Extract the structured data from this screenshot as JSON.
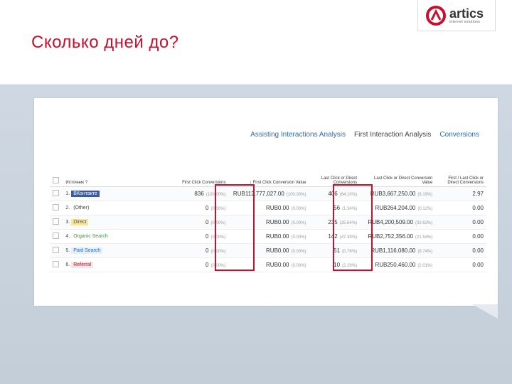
{
  "slide": {
    "title": "Сколько дней до?"
  },
  "logo": {
    "name": "artics",
    "sub": "internet solutions"
  },
  "report": {
    "tabs": [
      "Assisting Interactions Analysis",
      "First Interaction Analysis",
      "Conversions"
    ],
    "columns": {
      "source": "Источник",
      "first_click_conv": "First Click Conversions",
      "first_click_value": "First Click Conversion Value",
      "last_click_conv": "Last Click or Direct Conversions",
      "last_click_value": "Last Click or Direct Conversion Value",
      "ratio": "First / Last Click or Direct Conversions"
    },
    "rows": [
      {
        "num": "1.",
        "name": "ВКонтакте",
        "chip_bg": "#3b5b9a",
        "chip_fg": "#ffffff",
        "fc": "836",
        "fc_pct": "(100.00%)",
        "fv": "RUB112,777,027.00",
        "fv_pct": "(100.00%)",
        "lc": "406",
        "lc_pct": "(64.10%)",
        "lv": "RUB3,667,250.00",
        "lv_pct": "(6.19%)",
        "ratio": "2.97"
      },
      {
        "num": "2.",
        "name": "(Other)",
        "chip_bg": "#ffffff",
        "chip_fg": "#444444",
        "fc": "0",
        "fc_pct": "(0.00%)",
        "fv": "RUB0.00",
        "fv_pct": "(0.00%)",
        "lc": "56",
        "lc_pct": "(1.34%)",
        "lv": "RUB264,204.00",
        "lv_pct": "(0.12%)",
        "ratio": "0.00"
      },
      {
        "num": "3.",
        "name": "Direct",
        "chip_bg": "#f6e79a",
        "chip_fg": "#555555",
        "fc": "0",
        "fc_pct": "(0.00%)",
        "fv": "RUB0.00",
        "fv_pct": "(0.00%)",
        "lc": "235",
        "lc_pct": "(25.64%)",
        "lv": "RUB4,200,509.00",
        "lv_pct": "(32.62%)",
        "ratio": "0.00"
      },
      {
        "num": "4.",
        "name": "Organic Search",
        "chip_bg": "#ffffff",
        "chip_fg": "#3a9a3a",
        "fc": "0",
        "fc_pct": "(0.00%)",
        "fv": "RUB0.00",
        "fv_pct": "(0.00%)",
        "lc": "142",
        "lc_pct": "(47.39%)",
        "lv": "RUB2,752,356.00",
        "lv_pct": "(21.54%)",
        "ratio": "0.00"
      },
      {
        "num": "5.",
        "name": "Paid Search",
        "chip_bg": "#e6eef8",
        "chip_fg": "#2a6ebb",
        "fc": "0",
        "fc_pct": "(0.00%)",
        "fv": "RUB0.00",
        "fv_pct": "(0.00%)",
        "lc": "51",
        "lc_pct": "(0.76%)",
        "lv": "RUB1,116,080.00",
        "lv_pct": "(8.74%)",
        "ratio": "0.00"
      },
      {
        "num": "6.",
        "name": "Referral",
        "chip_bg": "#fbe4e6",
        "chip_fg": "#c8102e",
        "fc": "0",
        "fc_pct": "(0.00%)",
        "fv": "RUB0.00",
        "fv_pct": "(0.00%)",
        "lc": "10",
        "lc_pct": "(2.29%)",
        "lv": "RUB250,460.00",
        "lv_pct": "(2.01%)",
        "ratio": "0.00"
      }
    ]
  }
}
